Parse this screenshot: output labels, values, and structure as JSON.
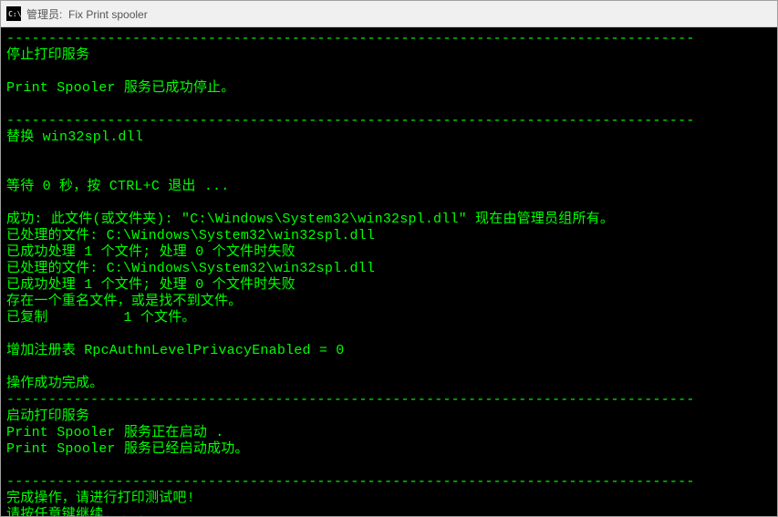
{
  "titlebar": {
    "label": "管理员:  Fix Print spooler"
  },
  "lines": [
    "----------------------------------------------------------------------------------",
    "停止打印服务",
    "",
    "Print Spooler 服务已成功停止。",
    "",
    "----------------------------------------------------------------------------------",
    "替换 win32spl.dll",
    "",
    "",
    "等待 0 秒，按 CTRL+C 退出 ...",
    "",
    "成功: 此文件(或文件夹): \"C:\\Windows\\System32\\win32spl.dll\" 现在由管理员组所有。",
    "已处理的文件: C:\\Windows\\System32\\win32spl.dll",
    "已成功处理 1 个文件; 处理 0 个文件时失败",
    "已处理的文件: C:\\Windows\\System32\\win32spl.dll",
    "已成功处理 1 个文件; 处理 0 个文件时失败",
    "存在一个重名文件，或是找不到文件。",
    "已复制         1 个文件。",
    "",
    "增加注册表 RpcAuthnLevelPrivacyEnabled = 0",
    "",
    "操作成功完成。",
    "----------------------------------------------------------------------------------",
    "启动打印服务",
    "Print Spooler 服务正在启动 .",
    "Print Spooler 服务已经启动成功。",
    "",
    "----------------------------------------------------------------------------------",
    "完成操作，请进行打印测试吧!",
    "请按任意键继续. . ."
  ]
}
